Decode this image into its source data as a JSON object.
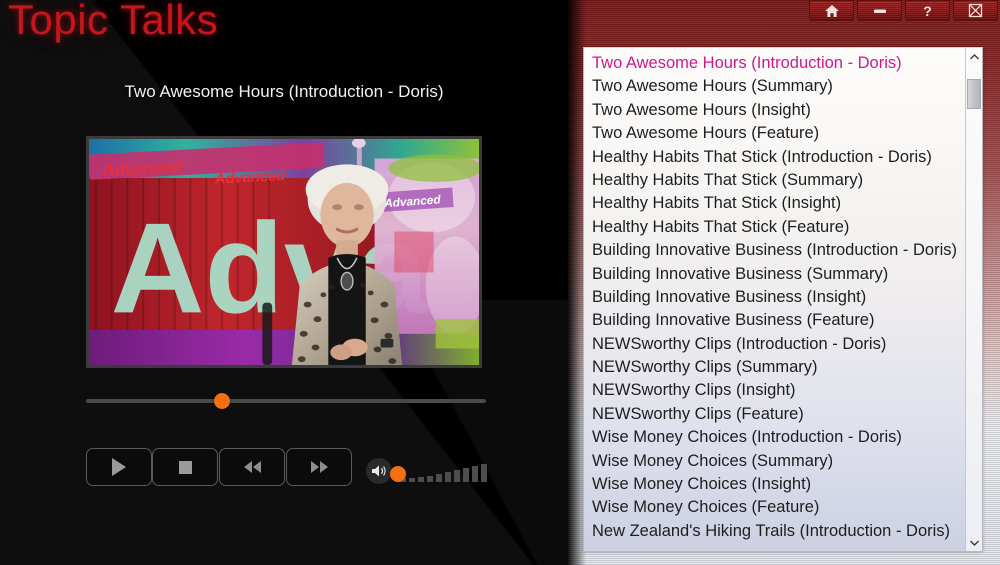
{
  "app": {
    "title": "Topic Talks",
    "brand_color": "#c4161c"
  },
  "window_controls": [
    {
      "name": "home",
      "icon": "home-icon",
      "label": ""
    },
    {
      "name": "minimize",
      "icon": "minimize-icon",
      "label": ""
    },
    {
      "name": "help",
      "icon": "question-mark-icon",
      "label": "?"
    },
    {
      "name": "close",
      "icon": "close-box-icon",
      "label": ""
    }
  ],
  "player": {
    "now_playing_title": "Two Awesome Hours (Introduction - Doris)",
    "progress_percent": 34,
    "volume_percent": 8,
    "controls": [
      {
        "name": "play",
        "label": "Play",
        "icon": "play-icon"
      },
      {
        "name": "stop",
        "label": "Stop",
        "icon": "stop-icon"
      },
      {
        "name": "rewind",
        "label": "Rewind",
        "icon": "rewind-icon"
      },
      {
        "name": "fast-forward",
        "label": "Fast Forward",
        "icon": "fast-forward-icon"
      }
    ],
    "volume_icon": "speaker-icon",
    "video_still_description": "Television studio set with 'Advanced' signage and a seated presenter"
  },
  "playlist": {
    "selected_index": 0,
    "selected_color": "#cc1a8d",
    "scrollbar": {
      "up_arrow": "chevron-up-icon",
      "down_arrow": "chevron-down-icon",
      "thumb_position_percent": 3
    },
    "items": [
      "Two Awesome Hours (Introduction - Doris)",
      "Two Awesome Hours (Summary)",
      "Two Awesome Hours (Insight)",
      "Two Awesome Hours (Feature)",
      "Healthy Habits That Stick (Introduction - Doris)",
      "Healthy Habits That Stick (Summary)",
      "Healthy Habits That Stick (Insight)",
      "Healthy Habits That Stick (Feature)",
      "Building Innovative Business (Introduction - Doris)",
      "Building Innovative Business (Summary)",
      "Building Innovative Business (Insight)",
      "Building Innovative Business (Feature)",
      "NEWSworthy Clips (Introduction - Doris)",
      "NEWSworthy Clips (Summary)",
      "NEWSworthy Clips (Insight)",
      "NEWSworthy Clips (Feature)",
      "Wise Money Choices (Introduction - Doris)",
      "Wise Money Choices (Summary)",
      "Wise Money Choices (Insight)",
      "Wise Money Choices (Feature)",
      "New Zealand's Hiking Trails (Introduction - Doris)"
    ]
  }
}
